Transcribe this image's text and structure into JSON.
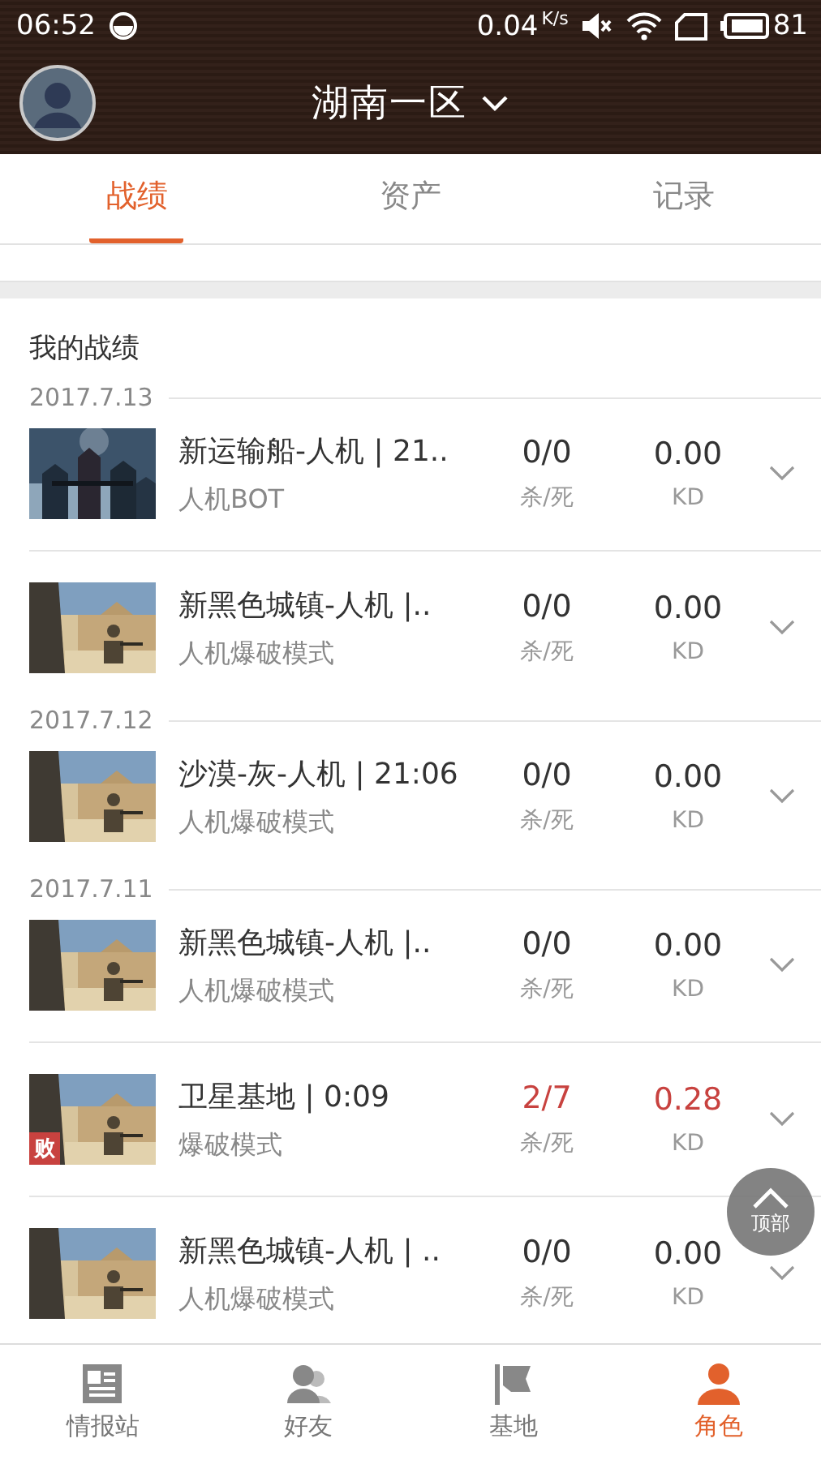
{
  "status_bar": {
    "time": "06:52",
    "speed": "0.04",
    "speed_unit": "K/s",
    "battery": "81"
  },
  "header": {
    "title": "湖南一区"
  },
  "tabs": [
    {
      "label": "战绩",
      "selected": true
    },
    {
      "label": "资产",
      "selected": false
    },
    {
      "label": "记录",
      "selected": false
    }
  ],
  "section": {
    "title": "我的战绩"
  },
  "groups": [
    {
      "date": "2017.7.13",
      "matches": [
        {
          "title": "新运输船-人机 | 21..",
          "mode": "人机BOT",
          "score": "0/0",
          "score_label": "杀/死",
          "kd": "0.00",
          "kd_label": "KD",
          "lost": false
        },
        {
          "title": "新黑色城镇-人机 |..",
          "mode": "人机爆破模式",
          "score": "0/0",
          "score_label": "杀/死",
          "kd": "0.00",
          "kd_label": "KD",
          "lost": false
        }
      ]
    },
    {
      "date": "2017.7.12",
      "matches": [
        {
          "title": "沙漠-灰-人机 | 21:06",
          "mode": "人机爆破模式",
          "score": "0/0",
          "score_label": "杀/死",
          "kd": "0.00",
          "kd_label": "KD",
          "lost": false
        }
      ]
    },
    {
      "date": "2017.7.11",
      "matches": [
        {
          "title": "新黑色城镇-人机 |..",
          "mode": "人机爆破模式",
          "score": "0/0",
          "score_label": "杀/死",
          "kd": "0.00",
          "kd_label": "KD",
          "lost": false
        },
        {
          "title": "卫星基地 | 0:09",
          "mode": "爆破模式",
          "score": "2/7",
          "score_label": "杀/死",
          "kd": "0.28",
          "kd_label": "KD",
          "lost": true,
          "badge": "败"
        },
        {
          "title": "新黑色城镇-人机 | ..",
          "mode": "人机爆破模式",
          "score": "0/0",
          "score_label": "杀/死",
          "kd": "0.00",
          "kd_label": "KD",
          "lost": false
        }
      ]
    }
  ],
  "top_button": {
    "label": "顶部"
  },
  "bottom_nav": [
    {
      "kind": "news",
      "label": "情报站",
      "selected": false
    },
    {
      "kind": "friends",
      "label": "好友",
      "selected": false
    },
    {
      "kind": "flag",
      "label": "基地",
      "selected": false
    },
    {
      "kind": "person",
      "label": "角色",
      "selected": true
    }
  ]
}
